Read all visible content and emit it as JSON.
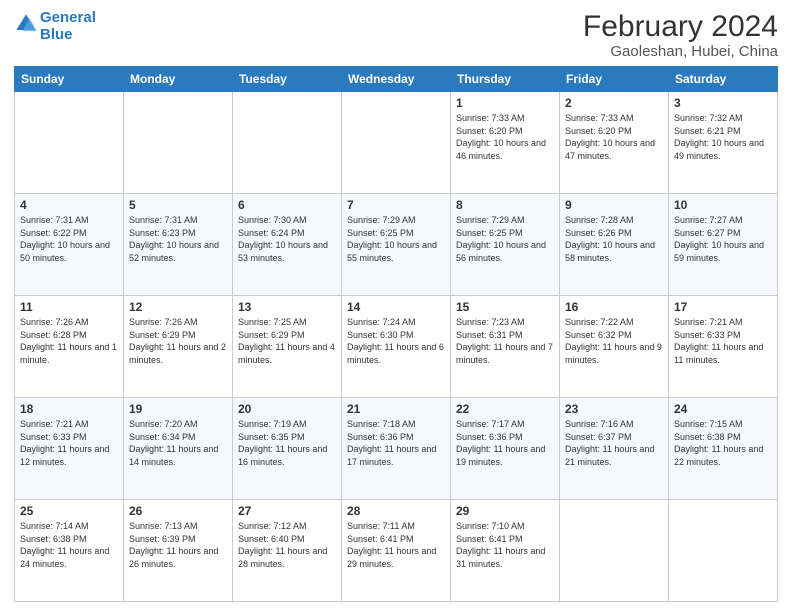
{
  "logo": {
    "line1": "General",
    "line2": "Blue"
  },
  "title": "February 2024",
  "subtitle": "Gaoleshan, Hubei, China",
  "weekdays": [
    "Sunday",
    "Monday",
    "Tuesday",
    "Wednesday",
    "Thursday",
    "Friday",
    "Saturday"
  ],
  "weeks": [
    [
      {
        "day": "",
        "sunrise": "",
        "sunset": "",
        "daylight": ""
      },
      {
        "day": "",
        "sunrise": "",
        "sunset": "",
        "daylight": ""
      },
      {
        "day": "",
        "sunrise": "",
        "sunset": "",
        "daylight": ""
      },
      {
        "day": "",
        "sunrise": "",
        "sunset": "",
        "daylight": ""
      },
      {
        "day": "1",
        "sunrise": "Sunrise: 7:33 AM",
        "sunset": "Sunset: 6:20 PM",
        "daylight": "Daylight: 10 hours and 46 minutes."
      },
      {
        "day": "2",
        "sunrise": "Sunrise: 7:33 AM",
        "sunset": "Sunset: 6:20 PM",
        "daylight": "Daylight: 10 hours and 47 minutes."
      },
      {
        "day": "3",
        "sunrise": "Sunrise: 7:32 AM",
        "sunset": "Sunset: 6:21 PM",
        "daylight": "Daylight: 10 hours and 49 minutes."
      }
    ],
    [
      {
        "day": "4",
        "sunrise": "Sunrise: 7:31 AM",
        "sunset": "Sunset: 6:22 PM",
        "daylight": "Daylight: 10 hours and 50 minutes."
      },
      {
        "day": "5",
        "sunrise": "Sunrise: 7:31 AM",
        "sunset": "Sunset: 6:23 PM",
        "daylight": "Daylight: 10 hours and 52 minutes."
      },
      {
        "day": "6",
        "sunrise": "Sunrise: 7:30 AM",
        "sunset": "Sunset: 6:24 PM",
        "daylight": "Daylight: 10 hours and 53 minutes."
      },
      {
        "day": "7",
        "sunrise": "Sunrise: 7:29 AM",
        "sunset": "Sunset: 6:25 PM",
        "daylight": "Daylight: 10 hours and 55 minutes."
      },
      {
        "day": "8",
        "sunrise": "Sunrise: 7:29 AM",
        "sunset": "Sunset: 6:25 PM",
        "daylight": "Daylight: 10 hours and 56 minutes."
      },
      {
        "day": "9",
        "sunrise": "Sunrise: 7:28 AM",
        "sunset": "Sunset: 6:26 PM",
        "daylight": "Daylight: 10 hours and 58 minutes."
      },
      {
        "day": "10",
        "sunrise": "Sunrise: 7:27 AM",
        "sunset": "Sunset: 6:27 PM",
        "daylight": "Daylight: 10 hours and 59 minutes."
      }
    ],
    [
      {
        "day": "11",
        "sunrise": "Sunrise: 7:26 AM",
        "sunset": "Sunset: 6:28 PM",
        "daylight": "Daylight: 11 hours and 1 minute."
      },
      {
        "day": "12",
        "sunrise": "Sunrise: 7:26 AM",
        "sunset": "Sunset: 6:29 PM",
        "daylight": "Daylight: 11 hours and 2 minutes."
      },
      {
        "day": "13",
        "sunrise": "Sunrise: 7:25 AM",
        "sunset": "Sunset: 6:29 PM",
        "daylight": "Daylight: 11 hours and 4 minutes."
      },
      {
        "day": "14",
        "sunrise": "Sunrise: 7:24 AM",
        "sunset": "Sunset: 6:30 PM",
        "daylight": "Daylight: 11 hours and 6 minutes."
      },
      {
        "day": "15",
        "sunrise": "Sunrise: 7:23 AM",
        "sunset": "Sunset: 6:31 PM",
        "daylight": "Daylight: 11 hours and 7 minutes."
      },
      {
        "day": "16",
        "sunrise": "Sunrise: 7:22 AM",
        "sunset": "Sunset: 6:32 PM",
        "daylight": "Daylight: 11 hours and 9 minutes."
      },
      {
        "day": "17",
        "sunrise": "Sunrise: 7:21 AM",
        "sunset": "Sunset: 6:33 PM",
        "daylight": "Daylight: 11 hours and 11 minutes."
      }
    ],
    [
      {
        "day": "18",
        "sunrise": "Sunrise: 7:21 AM",
        "sunset": "Sunset: 6:33 PM",
        "daylight": "Daylight: 11 hours and 12 minutes."
      },
      {
        "day": "19",
        "sunrise": "Sunrise: 7:20 AM",
        "sunset": "Sunset: 6:34 PM",
        "daylight": "Daylight: 11 hours and 14 minutes."
      },
      {
        "day": "20",
        "sunrise": "Sunrise: 7:19 AM",
        "sunset": "Sunset: 6:35 PM",
        "daylight": "Daylight: 11 hours and 16 minutes."
      },
      {
        "day": "21",
        "sunrise": "Sunrise: 7:18 AM",
        "sunset": "Sunset: 6:36 PM",
        "daylight": "Daylight: 11 hours and 17 minutes."
      },
      {
        "day": "22",
        "sunrise": "Sunrise: 7:17 AM",
        "sunset": "Sunset: 6:36 PM",
        "daylight": "Daylight: 11 hours and 19 minutes."
      },
      {
        "day": "23",
        "sunrise": "Sunrise: 7:16 AM",
        "sunset": "Sunset: 6:37 PM",
        "daylight": "Daylight: 11 hours and 21 minutes."
      },
      {
        "day": "24",
        "sunrise": "Sunrise: 7:15 AM",
        "sunset": "Sunset: 6:38 PM",
        "daylight": "Daylight: 11 hours and 22 minutes."
      }
    ],
    [
      {
        "day": "25",
        "sunrise": "Sunrise: 7:14 AM",
        "sunset": "Sunset: 6:38 PM",
        "daylight": "Daylight: 11 hours and 24 minutes."
      },
      {
        "day": "26",
        "sunrise": "Sunrise: 7:13 AM",
        "sunset": "Sunset: 6:39 PM",
        "daylight": "Daylight: 11 hours and 26 minutes."
      },
      {
        "day": "27",
        "sunrise": "Sunrise: 7:12 AM",
        "sunset": "Sunset: 6:40 PM",
        "daylight": "Daylight: 11 hours and 28 minutes."
      },
      {
        "day": "28",
        "sunrise": "Sunrise: 7:11 AM",
        "sunset": "Sunset: 6:41 PM",
        "daylight": "Daylight: 11 hours and 29 minutes."
      },
      {
        "day": "29",
        "sunrise": "Sunrise: 7:10 AM",
        "sunset": "Sunset: 6:41 PM",
        "daylight": "Daylight: 11 hours and 31 minutes."
      },
      {
        "day": "",
        "sunrise": "",
        "sunset": "",
        "daylight": ""
      },
      {
        "day": "",
        "sunrise": "",
        "sunset": "",
        "daylight": ""
      }
    ]
  ]
}
